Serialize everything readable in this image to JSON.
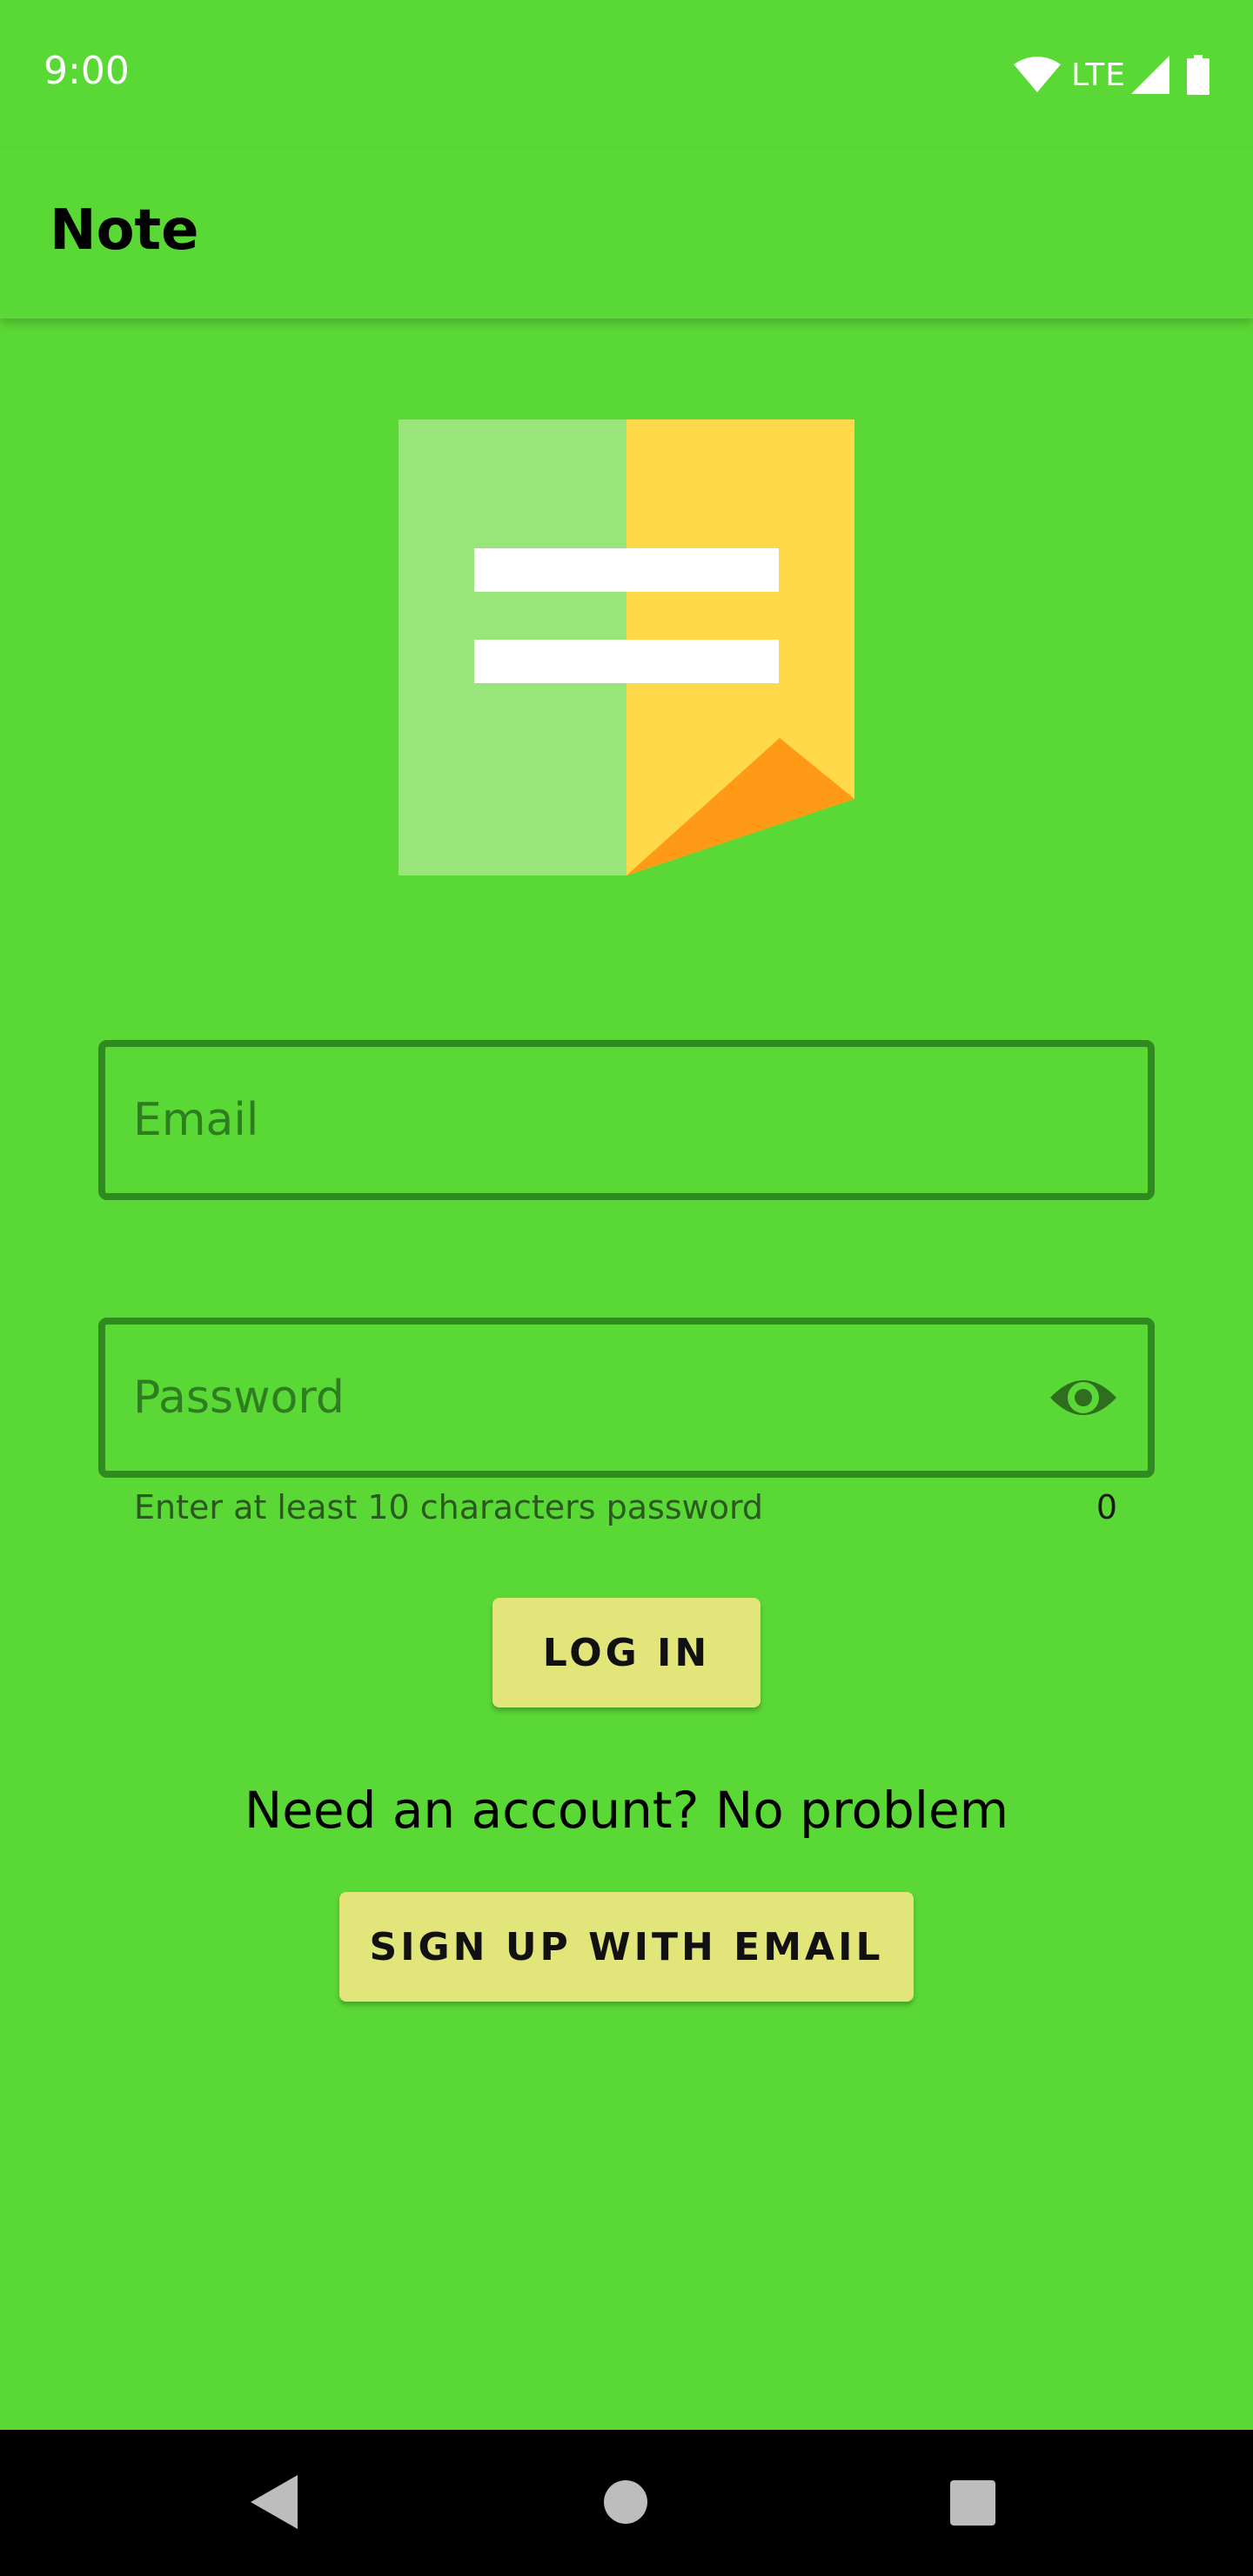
{
  "status_bar": {
    "time": "9:00",
    "network_label": "LTE",
    "icons": [
      "wifi-icon",
      "signal-icon",
      "battery-icon"
    ]
  },
  "app_bar": {
    "title": "Note"
  },
  "logo": {
    "icon": "note-logo-icon",
    "colors": {
      "left_panel": "#98E57A",
      "right_panel": "#FFD94A",
      "fold": "#FF9A17",
      "lines": "#FFFFFF"
    }
  },
  "form": {
    "email": {
      "placeholder": "Email",
      "value": ""
    },
    "password": {
      "placeholder": "Password",
      "value": "",
      "helper": "Enter at least 10 characters password",
      "counter": "0",
      "toggle_icon": "eye-icon"
    },
    "login_label": "LOG IN",
    "signup_prompt": "Need an account? No problem",
    "signup_label": "SIGN UP WITH EMAIL"
  },
  "nav_bar": {
    "icons": [
      "back-icon",
      "home-icon",
      "recents-icon"
    ]
  },
  "colors": {
    "background": "#5AD835",
    "field_border": "#2F8A1F",
    "button": "#E2E57A",
    "nav_bar": "#000000"
  }
}
